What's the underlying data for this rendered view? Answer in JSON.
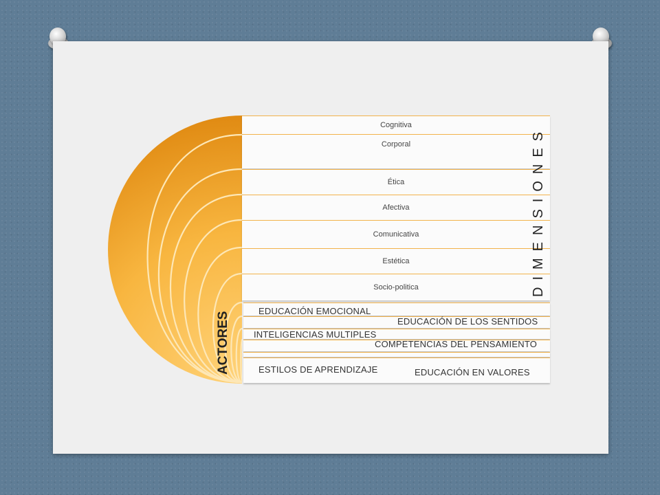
{
  "diagram": {
    "dimensions_label": "DIMENSIONES",
    "actors_label": "ACTORES",
    "dimensions": [
      {
        "label": "Cognitiva"
      },
      {
        "label": "Corporal"
      },
      {
        "label": "Ética"
      },
      {
        "label": "Afectiva"
      },
      {
        "label": "Comunicativa"
      },
      {
        "label": "Estética"
      },
      {
        "label": "Socio-politica"
      }
    ],
    "approaches": [
      {
        "label": "EDUCACIÓN EMOCIONAL"
      },
      {
        "label": "EDUCACIÓN DE LOS SENTIDOS"
      },
      {
        "label": "INTELIGENCIAS MULTIPLES"
      },
      {
        "label": "COMPETENCIAS DEL PENSAMIENTO"
      },
      {
        "label": "ESTILOS DE APRENDIZAJE"
      },
      {
        "label": "EDUCACIÓN EN VALORES"
      }
    ]
  },
  "colors": {
    "fan_light": "#f8b640",
    "fan_dark": "#e08a12",
    "ring": "#fde7b6",
    "background": "#5f7d96",
    "slide": "#efefef"
  }
}
